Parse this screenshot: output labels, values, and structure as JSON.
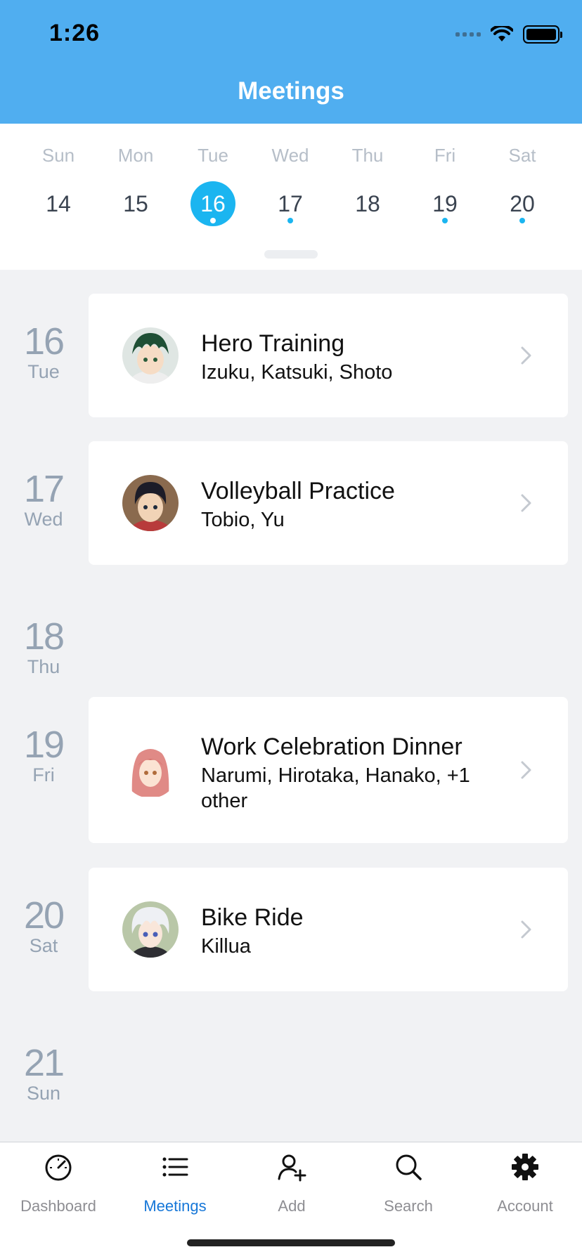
{
  "status_bar": {
    "time": "1:26"
  },
  "header": {
    "title": "Meetings"
  },
  "week": [
    {
      "dow": "Sun",
      "day": "14",
      "selected": false,
      "has_meeting": false
    },
    {
      "dow": "Mon",
      "day": "15",
      "selected": false,
      "has_meeting": false
    },
    {
      "dow": "Tue",
      "day": "16",
      "selected": true,
      "has_meeting": true
    },
    {
      "dow": "Wed",
      "day": "17",
      "selected": false,
      "has_meeting": true
    },
    {
      "dow": "Thu",
      "day": "18",
      "selected": false,
      "has_meeting": false
    },
    {
      "dow": "Fri",
      "day": "19",
      "selected": false,
      "has_meeting": true
    },
    {
      "dow": "Sat",
      "day": "20",
      "selected": false,
      "has_meeting": true
    }
  ],
  "agenda": [
    {
      "day": "16",
      "dow": "Tue",
      "meeting": {
        "title": "Hero Training",
        "attendees": "Izuku, Katsuki, Shoto",
        "avatar": "green-hair-avatar"
      }
    },
    {
      "day": "17",
      "dow": "Wed",
      "meeting": {
        "title": "Volleyball Practice",
        "attendees": "Tobio, Yu",
        "avatar": "dark-hair-avatar"
      }
    },
    {
      "day": "18",
      "dow": "Thu"
    },
    {
      "day": "19",
      "dow": "Fri",
      "meeting": {
        "title": "Work Celebration Dinner",
        "attendees": "Narumi, Hirotaka, Hanako, +1 other",
        "avatar": "pink-hair-avatar"
      }
    },
    {
      "day": "20",
      "dow": "Sat",
      "meeting": {
        "title": "Bike Ride",
        "attendees": "Killua",
        "avatar": "white-hair-avatar"
      }
    },
    {
      "day": "21",
      "dow": "Sun"
    }
  ],
  "tabs": [
    {
      "label": "Dashboard",
      "icon": "speedometer-icon",
      "active": false
    },
    {
      "label": "Meetings",
      "icon": "list-icon",
      "active": true
    },
    {
      "label": "Add",
      "icon": "add-person-icon",
      "active": false
    },
    {
      "label": "Search",
      "icon": "search-icon",
      "active": false
    },
    {
      "label": "Account",
      "icon": "gear-icon",
      "active": false
    }
  ],
  "colors": {
    "header": "#50aef0",
    "accent": "#1bb5f0",
    "active_tab": "#1677d8"
  }
}
